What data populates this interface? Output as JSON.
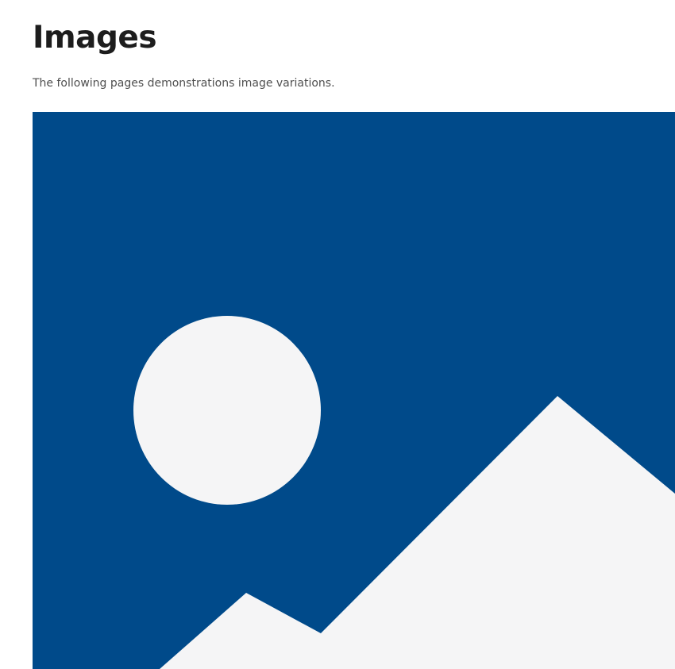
{
  "page": {
    "title": "Images",
    "description": "The following pages demonstrations image variations."
  },
  "placeholder_image": {
    "icon": "image-placeholder-icon",
    "background_color": "#004a8a",
    "shape_color": "#f5f5f6"
  }
}
